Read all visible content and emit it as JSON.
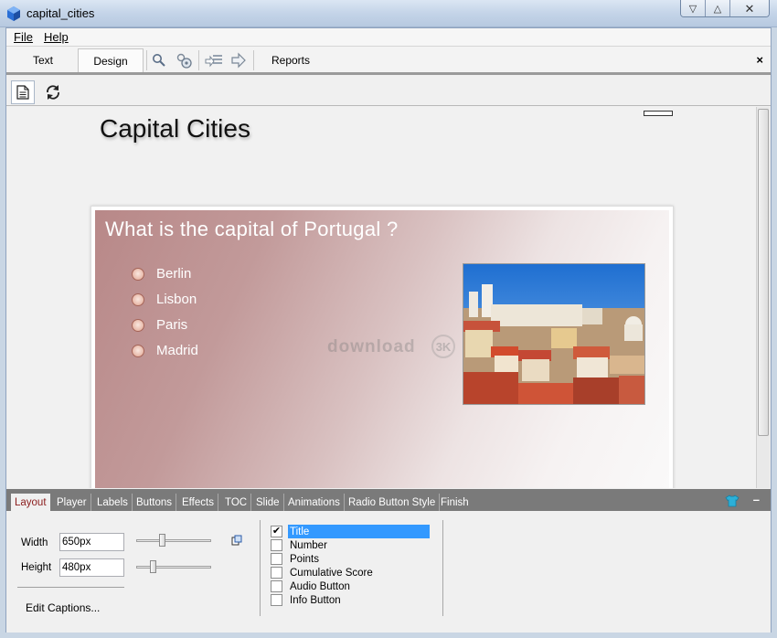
{
  "window": {
    "title": "capital_cities",
    "minimize_glyph": "▽",
    "maximize_glyph": "△",
    "close_glyph": "✕"
  },
  "menu": {
    "file": "File",
    "help": "Help"
  },
  "ribbon": {
    "tabs": {
      "text": "Text",
      "design": "Design",
      "reports": "Reports"
    },
    "close_glyph": "×",
    "icons": [
      "search-icon",
      "settings-search-icon",
      "import-list-icon",
      "forward-arrow-icon"
    ]
  },
  "toolstrip": {
    "icons": [
      "page-icon",
      "refresh-icon"
    ]
  },
  "canvas": {
    "course_title": "Capital Cities",
    "question": "What is the capital of Portugal ?",
    "options": [
      "Berlin",
      "Lisbon",
      "Paris",
      "Madrid"
    ],
    "photo_icon": "lisbon-city-photo",
    "watermark": "download",
    "watermark_mark": "3K"
  },
  "properties": {
    "tabs": [
      "Layout",
      "Player",
      "Labels",
      "Buttons",
      "Effects",
      "TOC",
      "Slide",
      "Animations",
      "Radio Button Style",
      "Finish"
    ],
    "active_tab": "Layout",
    "minimize_glyph": "–",
    "width_label": "Width",
    "width_value": "650px",
    "height_label": "Height",
    "height_value": "480px",
    "width_slider_fraction": 0.33,
    "height_slider_fraction": 0.2,
    "edit_captions": "Edit Captions...",
    "checkboxes": [
      {
        "label": "Title",
        "checked": true,
        "selected": true
      },
      {
        "label": "Number",
        "checked": false
      },
      {
        "label": "Points",
        "checked": false
      },
      {
        "label": "Cumulative Score",
        "checked": false
      },
      {
        "label": "Audio Button",
        "checked": false
      },
      {
        "label": "Info Button",
        "checked": false
      }
    ],
    "check_glyph": "✔"
  },
  "colors": {
    "active_tab_text": "#8b1d1d",
    "selection": "#3399ff",
    "panel_tab_bar": "#7a7a7a"
  }
}
